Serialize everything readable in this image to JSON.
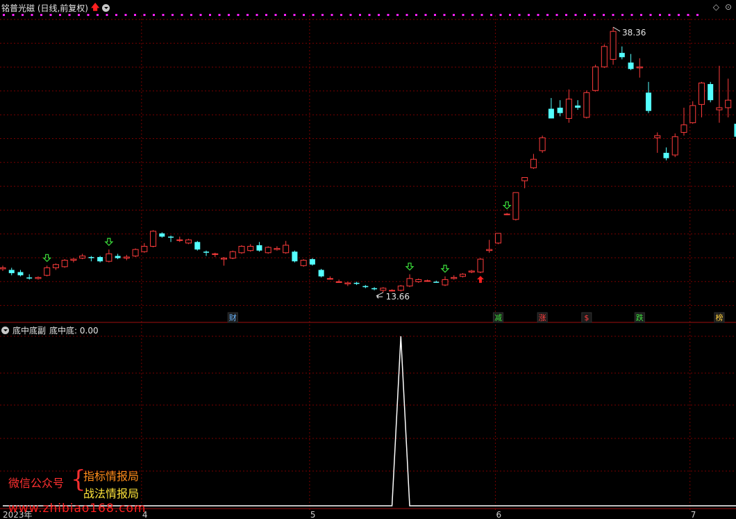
{
  "header": {
    "title": "铭普光磁 (日线,前复权)",
    "arrow_glyph": "🡅"
  },
  "indicator": {
    "panel_name": "底中底副",
    "value_label": "底中底: 0.00"
  },
  "top_right": {
    "diamond": "◇",
    "close": "⊙"
  },
  "price_panel": {
    "ymin": 11.5,
    "ymax": 39.5,
    "high_label": "38.36",
    "low_label": "13.66",
    "candles": [
      [
        15.9,
        16.2,
        15.7,
        16.0
      ],
      [
        15.8,
        16.0,
        15.3,
        15.5
      ],
      [
        15.6,
        15.8,
        15.2,
        15.3
      ],
      [
        15.1,
        15.4,
        14.9,
        15.0
      ],
      [
        15.0,
        15.2,
        14.9,
        15.1
      ],
      [
        15.3,
        16.2,
        15.2,
        16.0
      ],
      [
        16.0,
        16.4,
        15.8,
        16.3
      ],
      [
        16.1,
        16.8,
        16.0,
        16.7
      ],
      [
        16.7,
        16.9,
        16.5,
        16.8
      ],
      [
        16.9,
        17.3,
        16.8,
        17.1
      ],
      [
        17.0,
        17.1,
        16.6,
        16.9
      ],
      [
        17.0,
        17.1,
        16.5,
        16.6
      ],
      [
        16.6,
        17.7,
        16.5,
        17.3
      ],
      [
        17.1,
        17.3,
        16.8,
        16.9
      ],
      [
        16.9,
        17.2,
        16.7,
        17.0
      ],
      [
        17.1,
        17.8,
        17.0,
        17.7
      ],
      [
        17.5,
        18.3,
        17.4,
        18.0
      ],
      [
        18.0,
        19.5,
        17.9,
        19.4
      ],
      [
        19.2,
        19.3,
        18.8,
        18.9
      ],
      [
        18.9,
        19.0,
        18.4,
        18.8
      ],
      [
        18.6,
        18.9,
        18.4,
        18.6
      ],
      [
        18.3,
        18.7,
        18.2,
        18.6
      ],
      [
        18.4,
        18.5,
        17.6,
        17.7
      ],
      [
        17.5,
        17.6,
        17.1,
        17.4
      ],
      [
        17.3,
        17.4,
        17.0,
        17.3
      ],
      [
        16.8,
        17.0,
        16.2,
        16.9
      ],
      [
        16.9,
        17.6,
        16.8,
        17.5
      ],
      [
        17.4,
        18.1,
        17.3,
        18.0
      ],
      [
        17.6,
        18.2,
        17.5,
        18.0
      ],
      [
        18.1,
        18.4,
        17.5,
        17.6
      ],
      [
        17.4,
        18.0,
        17.3,
        17.9
      ],
      [
        17.7,
        18.0,
        17.6,
        17.8
      ],
      [
        17.4,
        18.5,
        17.3,
        18.1
      ],
      [
        17.5,
        17.6,
        16.5,
        16.6
      ],
      [
        16.2,
        16.8,
        16.1,
        16.7
      ],
      [
        16.8,
        16.9,
        16.2,
        16.3
      ],
      [
        15.8,
        15.9,
        15.1,
        15.2
      ],
      [
        15.0,
        15.2,
        14.9,
        15.0
      ],
      [
        14.7,
        14.9,
        14.6,
        14.7
      ],
      [
        14.5,
        14.7,
        14.3,
        14.6
      ],
      [
        14.6,
        14.7,
        14.4,
        14.5
      ],
      [
        14.3,
        14.4,
        14.1,
        14.2
      ],
      [
        14.1,
        14.2,
        13.9,
        14.0
      ],
      [
        13.9,
        14.2,
        13.7,
        14.1
      ],
      [
        13.9,
        14.0,
        13.8,
        13.9
      ],
      [
        13.9,
        14.4,
        13.8,
        14.3
      ],
      [
        14.3,
        15.4,
        14.2,
        15.0
      ],
      [
        14.7,
        15.0,
        14.6,
        14.9
      ],
      [
        14.8,
        14.9,
        14.7,
        14.8
      ],
      [
        14.7,
        14.8,
        14.6,
        14.6
      ],
      [
        14.4,
        15.2,
        14.3,
        14.9
      ],
      [
        15.0,
        15.3,
        14.9,
        15.1
      ],
      [
        15.2,
        15.5,
        15.1,
        15.4
      ],
      [
        15.6,
        15.8,
        15.5,
        15.7
      ],
      [
        15.6,
        16.9,
        15.5,
        16.8
      ],
      [
        17.6,
        18.6,
        17.4,
        17.7
      ],
      [
        18.3,
        19.2,
        18.2,
        19.2
      ],
      [
        21.0,
        21.1,
        20.9,
        21.0
      ],
      [
        20.5,
        23.0,
        20.4,
        23.0
      ],
      [
        24.1,
        24.4,
        23.4,
        24.4
      ],
      [
        25.3,
        26.6,
        25.2,
        26.1
      ],
      [
        26.9,
        28.3,
        26.7,
        28.1
      ],
      [
        30.8,
        31.8,
        29.9,
        29.9
      ],
      [
        30.9,
        31.6,
        30.1,
        30.4
      ],
      [
        29.9,
        32.6,
        29.5,
        31.7
      ],
      [
        31.1,
        31.6,
        30.7,
        30.9
      ],
      [
        30.0,
        32.5,
        29.9,
        32.3
      ],
      [
        32.5,
        34.9,
        32.4,
        34.7
      ],
      [
        34.7,
        36.8,
        34.6,
        36.6
      ],
      [
        35.4,
        38.4,
        34.9,
        38.0
      ],
      [
        36.0,
        36.6,
        35.4,
        35.6
      ],
      [
        35.1,
        35.9,
        34.4,
        34.5
      ],
      [
        34.6,
        35.5,
        33.7,
        34.7
      ],
      [
        32.3,
        33.3,
        30.4,
        30.6
      ],
      [
        28.1,
        28.6,
        26.7,
        28.3
      ],
      [
        26.7,
        27.2,
        26.0,
        26.2
      ],
      [
        26.5,
        28.5,
        26.3,
        28.2
      ],
      [
        28.6,
        30.9,
        28.3,
        29.3
      ],
      [
        29.5,
        31.5,
        29.4,
        31.1
      ],
      [
        31.2,
        33.3,
        30.0,
        33.2
      ],
      [
        33.1,
        33.3,
        31.4,
        31.6
      ],
      [
        30.7,
        34.8,
        29.5,
        30.9
      ],
      [
        30.9,
        33.6,
        30.0,
        31.6
      ],
      [
        29.4,
        29.9,
        28.2,
        28.2
      ]
    ],
    "signals": [
      {
        "type": "green-down",
        "index": 5
      },
      {
        "type": "green-down",
        "index": 12
      },
      {
        "type": "green-down",
        "index": 46
      },
      {
        "type": "green-down",
        "index": 50
      },
      {
        "type": "green-down",
        "index": 57
      },
      {
        "type": "red-up",
        "index": 54
      }
    ],
    "event_tags": [
      {
        "text": "财",
        "index": 26,
        "color": "#6cb8ff"
      },
      {
        "text": "减",
        "index": 56,
        "color": "#40e040"
      },
      {
        "text": "涨",
        "index": 61,
        "color": "#ff4040"
      },
      {
        "text": "$",
        "index": 66,
        "color": "#ff4040"
      },
      {
        "text": "跌",
        "index": 72,
        "color": "#40e040"
      },
      {
        "text": "榜",
        "index": 81,
        "color": "#ffd040"
      }
    ]
  },
  "indicator_panel": {
    "ymax": 1.0,
    "peak_index": 45,
    "baseline_value": 0
  },
  "x_axis": {
    "labels": [
      "2023年",
      "4",
      "5",
      "6",
      "7"
    ],
    "label_indexes": [
      1,
      16,
      35,
      56,
      78
    ]
  },
  "watermark": {
    "left_text": "微信公众号",
    "brace": "{",
    "line1": "指标情报局",
    "line2": "战法情报局",
    "url": "www.zhibiao168.com"
  },
  "colors": {
    "up": "#ff3c3c",
    "down": "#54ffff",
    "grid": "#7a0000",
    "divider": "#a01010",
    "marker": "#ff20ff",
    "indicator_line": "#ffffff"
  }
}
